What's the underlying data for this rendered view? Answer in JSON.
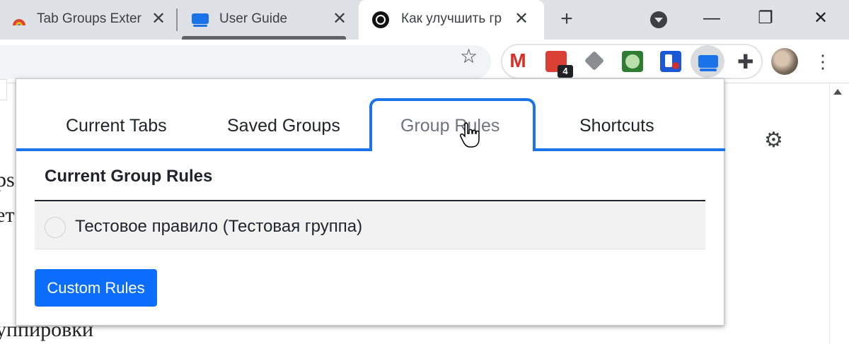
{
  "tabs": [
    {
      "title": "Tab Groups Exter",
      "close": "✕"
    },
    {
      "title": "User Guide",
      "close": "✕"
    },
    {
      "title": "Как улучшить гр",
      "close": "✕"
    }
  ],
  "new_tab": "+",
  "window": {
    "minimize": "—",
    "restore": "❐",
    "close": "✕"
  },
  "toolbar": {
    "bookmark": "☆",
    "menu": "⋮",
    "extensions": "✚"
  },
  "extensions": {
    "todoist_badge": "4"
  },
  "background_page": {
    "line1": "ps",
    "line2": "ет",
    "line3": "уппировки"
  },
  "settings_icon": "⚙",
  "popup": {
    "tabs": [
      "Current Tabs",
      "Saved Groups",
      "Group Rules",
      "Shortcuts"
    ],
    "active_tab": "Group Rules",
    "section_title": "Current Group Rules",
    "rules": [
      {
        "label": "Тестовое правило (Тестовая группа)"
      }
    ],
    "custom_rules_button": "Custom Rules"
  },
  "colors": {
    "accent": "#1a73e8",
    "button": "#0d6efd",
    "tabstrip": "#dee1e6"
  }
}
